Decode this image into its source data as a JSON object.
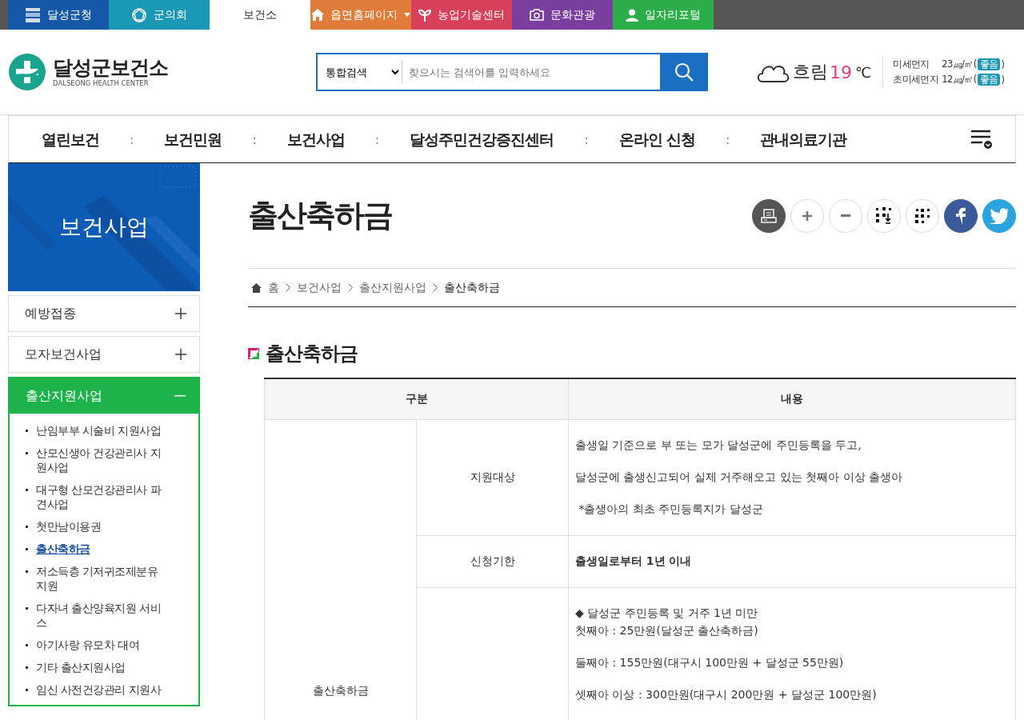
{
  "top_bar": {
    "items": [
      {
        "label": "달성군청",
        "kind": "emblem",
        "color": "#1558a8",
        "selected": false
      },
      {
        "label": "군의회",
        "kind": "seal",
        "color": "#1a98b6",
        "selected": false
      },
      {
        "label": "보건소",
        "kind": "none",
        "color": "#ffffff",
        "selected": true
      },
      {
        "label": "읍면홈페이지",
        "kind": "home",
        "color": "#e07b39",
        "selected": false,
        "dropdown": true
      },
      {
        "label": "농업기술센터",
        "kind": "sprout",
        "color": "#d8405a",
        "selected": false
      },
      {
        "label": "문화관광",
        "kind": "camera",
        "color": "#7a3e9e",
        "selected": false
      },
      {
        "label": "일자리포털",
        "kind": "person",
        "color": "#2bae4a",
        "selected": false
      }
    ]
  },
  "header": {
    "logo": {
      "name": "달성군보건소",
      "subtitle": "DALSEONG HEALTH CENTER"
    },
    "search": {
      "scope": "통합검색",
      "placeholder": "찾으시는 검색어를 입력하세요"
    },
    "weather": {
      "condition": "흐림",
      "temperature": "19",
      "unit": "℃"
    },
    "dust": [
      {
        "label": "미세먼지",
        "reading": "23㎍/㎥(",
        "grade": "좋음",
        "close": ")"
      },
      {
        "label": "초미세먼지",
        "reading": "12㎍/㎥(",
        "grade": "좋음",
        "close": ")"
      }
    ]
  },
  "nav": {
    "items": [
      {
        "label": "열린보건"
      },
      {
        "label": "보건민원"
      },
      {
        "label": "보건사업"
      },
      {
        "label": "달성주민건강증진센터"
      },
      {
        "label": "온라인 신청"
      },
      {
        "label": "관내의료기관"
      }
    ],
    "separators": [
      ":",
      ":",
      ":",
      ":",
      ":"
    ]
  },
  "sidebar": {
    "title": "보건사업",
    "items": [
      {
        "label": "예방접종",
        "expanded": false
      },
      {
        "label": "모자보건사업",
        "expanded": false
      },
      {
        "label": "출산지원사업",
        "expanded": true,
        "children": [
          {
            "label": "난임부부 시술비 지원사업",
            "selected": false
          },
          {
            "label": "산모신생아 건강관리사 지원사업",
            "selected": false
          },
          {
            "label": "대구형 산모건강관리사 파견사업",
            "selected": false
          },
          {
            "label": "첫만남이용권",
            "selected": false
          },
          {
            "label": "출산축하금",
            "selected": true
          },
          {
            "label": "저소득층 기저귀조제분유 지원",
            "selected": false
          },
          {
            "label": "다자녀 출산양육지원 서비스",
            "selected": false
          },
          {
            "label": "아기사랑 유모차 대여",
            "selected": false
          },
          {
            "label": "기타 출산지원사업",
            "selected": false
          },
          {
            "label": "임신 사전건강관리 지원사",
            "selected": false
          }
        ]
      }
    ]
  },
  "page": {
    "title": "출산축하금",
    "breadcrumb": [
      {
        "label": "홈",
        "current": false
      },
      {
        "label": "보건사업",
        "current": false
      },
      {
        "label": "출산지원사업",
        "current": false
      },
      {
        "label": "출산축하금",
        "current": true
      }
    ],
    "section_title": "출산축하금",
    "table": {
      "columns": [
        "구분",
        "내용"
      ],
      "group": "출산축하금",
      "rows": [
        {
          "label": "지원대상",
          "emphasis": false,
          "paragraphs": [
            [
              "출생일 기준으로 부 또는 모가 달성군에 주민등록을 두고,"
            ],
            [
              "달성군에 출생신고되어 실제 거주해오고 있는 첫째아 이상 출생아"
            ],
            [
              " *출생아의 최초 주민등록지가 달성군"
            ]
          ]
        },
        {
          "label": "신청기한",
          "emphasis": true,
          "paragraphs": [
            [
              "출생일로부터 1년 이내"
            ]
          ]
        },
        {
          "emphasis": false,
          "paragraphs": [
            [
              "◆ 달성군 주민등록 및 거주 1년 미만",
              "첫째아 : 25만원(달성군 출산축하금)"
            ],
            [
              "둘째아 : 155만원(대구시 100만원 + 달성군 55만원)"
            ],
            [
              "셋째아 이상 : 300만원(대구시 200만원 + 달성군 100만원)"
            ]
          ]
        }
      ]
    }
  }
}
